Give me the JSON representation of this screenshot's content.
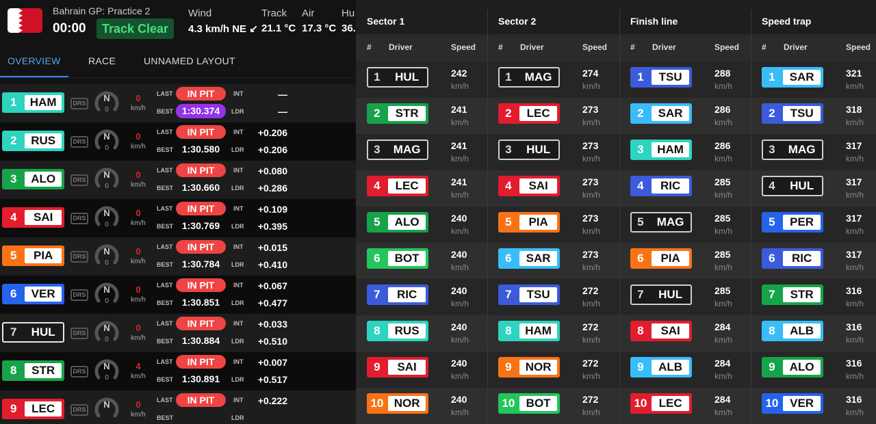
{
  "header": {
    "session": "Bahrain GP: Practice 2",
    "clock": "00:00",
    "track_status": "Track Clear",
    "weather": [
      {
        "label": "Wind",
        "value": "4.3 km/h NE ↙"
      },
      {
        "label": "Track",
        "value": "21.1 °C"
      },
      {
        "label": "Air",
        "value": "17.3 °C"
      },
      {
        "label": "Hu",
        "value": "36."
      }
    ]
  },
  "tabs": [
    {
      "label": "OVERVIEW",
      "active": true
    },
    {
      "label": "RACE"
    },
    {
      "label": "UNNAMED LAYOUT"
    }
  ],
  "labels": {
    "drs": "DRS",
    "gear": "N",
    "kmh": "km/h",
    "last": "LAST",
    "best": "BEST",
    "int": "INT",
    "ldr": "LDR"
  },
  "colors": {
    "HAM": "#2dd4bf",
    "RUS": "#2dd4bf",
    "ALO": "#16a34a",
    "SAI": "#e11d2e",
    "PIA": "#f97316",
    "VER": "#2563eb",
    "HUL": "#e5e7eb",
    "STR": "#16a34a",
    "LEC": "#e11d2e",
    "MAG": "#e5e7eb",
    "BOT": "#22c55e",
    "RIC": "#3b5bdb",
    "NOR": "#f97316",
    "TSU": "#3b5bdb",
    "SAR": "#38bdf8",
    "PER": "#2563eb",
    "ALB": "#38bdf8"
  },
  "drivers": [
    {
      "pos": "1",
      "code": "HAM",
      "speed": "0",
      "gear_speed": "0",
      "last": "IN PIT",
      "best": "1:30.374",
      "best_fastest": true,
      "int": "—",
      "ldr": "—"
    },
    {
      "pos": "2",
      "code": "RUS",
      "speed": "0",
      "gear_speed": "0",
      "last": "IN PIT",
      "best": "1:30.580",
      "int": "+0.206",
      "ldr": "+0.206"
    },
    {
      "pos": "3",
      "code": "ALO",
      "speed": "0",
      "gear_speed": "0",
      "last": "IN PIT",
      "best": "1:30.660",
      "int": "+0.080",
      "ldr": "+0.286"
    },
    {
      "pos": "4",
      "code": "SAI",
      "speed": "0",
      "gear_speed": "0",
      "last": "IN PIT",
      "best": "1:30.769",
      "int": "+0.109",
      "ldr": "+0.395"
    },
    {
      "pos": "5",
      "code": "PIA",
      "speed": "0",
      "gear_speed": "0",
      "last": "IN PIT",
      "best": "1:30.784",
      "int": "+0.015",
      "ldr": "+0.410"
    },
    {
      "pos": "6",
      "code": "VER",
      "speed": "0",
      "gear_speed": "0",
      "last": "IN PIT",
      "best": "1:30.851",
      "int": "+0.067",
      "ldr": "+0.477"
    },
    {
      "pos": "7",
      "code": "HUL",
      "speed": "0",
      "gear_speed": "0",
      "last": "IN PIT",
      "best": "1:30.884",
      "int": "+0.033",
      "ldr": "+0.510"
    },
    {
      "pos": "8",
      "code": "STR",
      "speed": "4",
      "gear_speed": "0",
      "last": "IN PIT",
      "best": "1:30.891",
      "int": "+0.007",
      "ldr": "+0.517"
    },
    {
      "pos": "9",
      "code": "LEC",
      "speed": "0",
      "gear_speed": "",
      "last": "IN PIT",
      "best": "",
      "int": "+0.222",
      "ldr": ""
    }
  ],
  "speed_table": {
    "sub": {
      "num": "#",
      "driver": "Driver",
      "speed": "Speed"
    },
    "unit": "km/h",
    "columns": [
      {
        "title": "Sector 1",
        "rows": [
          [
            "1",
            "HUL",
            "242"
          ],
          [
            "2",
            "STR",
            "241"
          ],
          [
            "3",
            "MAG",
            "241"
          ],
          [
            "4",
            "LEC",
            "241"
          ],
          [
            "5",
            "ALO",
            "240"
          ],
          [
            "6",
            "BOT",
            "240"
          ],
          [
            "7",
            "RIC",
            "240"
          ],
          [
            "8",
            "RUS",
            "240"
          ],
          [
            "9",
            "SAI",
            "240"
          ],
          [
            "10",
            "NOR",
            "240"
          ]
        ]
      },
      {
        "title": "Sector 2",
        "rows": [
          [
            "1",
            "MAG",
            "274"
          ],
          [
            "2",
            "LEC",
            "273"
          ],
          [
            "3",
            "HUL",
            "273"
          ],
          [
            "4",
            "SAI",
            "273"
          ],
          [
            "5",
            "PIA",
            "273"
          ],
          [
            "6",
            "SAR",
            "273"
          ],
          [
            "7",
            "TSU",
            "272"
          ],
          [
            "8",
            "HAM",
            "272"
          ],
          [
            "9",
            "NOR",
            "272"
          ],
          [
            "10",
            "BOT",
            "272"
          ]
        ]
      },
      {
        "title": "Finish line",
        "rows": [
          [
            "1",
            "TSU",
            "288"
          ],
          [
            "2",
            "SAR",
            "286"
          ],
          [
            "3",
            "HAM",
            "286"
          ],
          [
            "4",
            "RIC",
            "285"
          ],
          [
            "5",
            "MAG",
            "285"
          ],
          [
            "6",
            "PIA",
            "285"
          ],
          [
            "7",
            "HUL",
            "285"
          ],
          [
            "8",
            "SAI",
            "284"
          ],
          [
            "9",
            "ALB",
            "284"
          ],
          [
            "10",
            "LEC",
            "284"
          ]
        ]
      },
      {
        "title": "Speed trap",
        "rows": [
          [
            "1",
            "SAR",
            "321"
          ],
          [
            "2",
            "TSU",
            "318"
          ],
          [
            "3",
            "MAG",
            "317"
          ],
          [
            "4",
            "HUL",
            "317"
          ],
          [
            "5",
            "PER",
            "317"
          ],
          [
            "6",
            "RIC",
            "317"
          ],
          [
            "7",
            "STR",
            "316"
          ],
          [
            "8",
            "ALB",
            "316"
          ],
          [
            "9",
            "ALO",
            "316"
          ],
          [
            "10",
            "VER",
            "316"
          ]
        ]
      }
    ]
  }
}
